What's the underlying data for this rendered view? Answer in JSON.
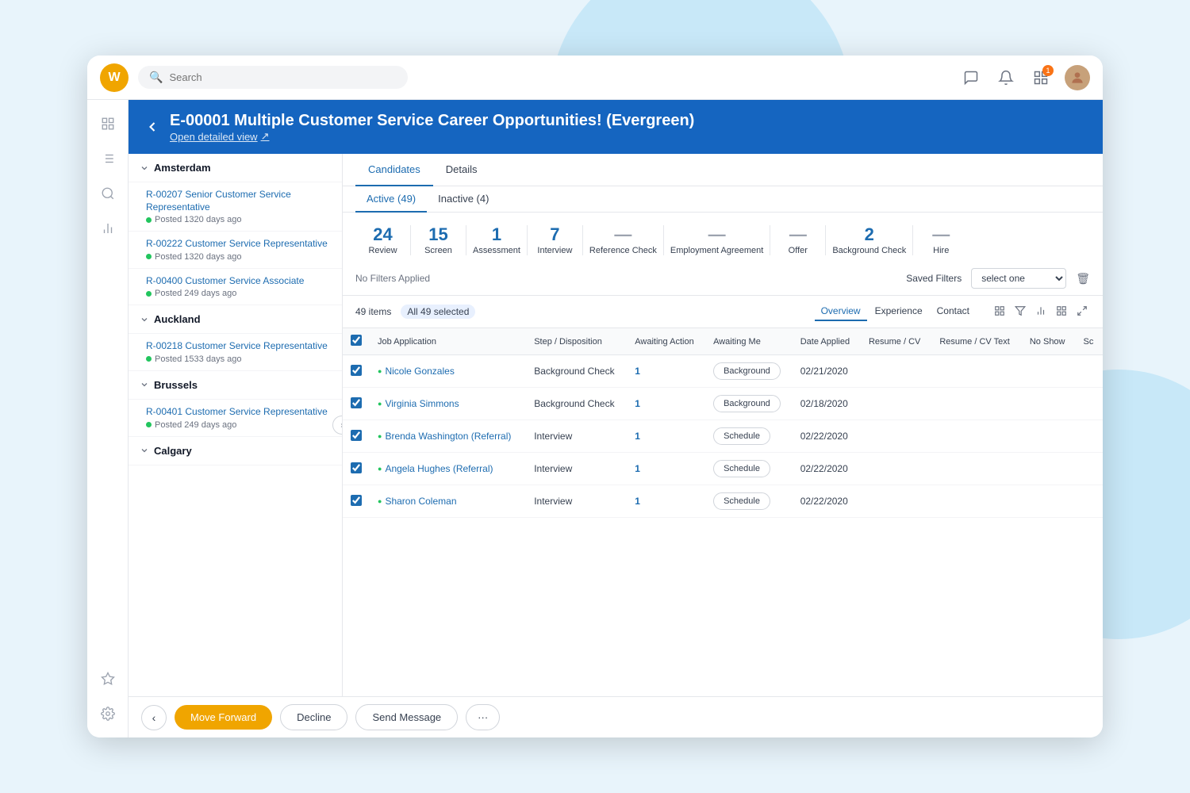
{
  "topbar": {
    "logo_letter": "W",
    "search_placeholder": "Search",
    "notification_badge": "1"
  },
  "header": {
    "back_label": "←",
    "title": "E-00001 Multiple Customer Service Career Opportunities! (Evergreen)",
    "subtitle": "Open detailed view",
    "subtitle_icon": "↗"
  },
  "tabs": {
    "main": [
      {
        "label": "Candidates",
        "active": true
      },
      {
        "label": "Details",
        "active": false
      }
    ],
    "sub": [
      {
        "label": "Active (49)",
        "active": true
      },
      {
        "label": "Inactive (4)",
        "active": false
      }
    ]
  },
  "stages": [
    {
      "count": "24",
      "label": "Review",
      "dim": false
    },
    {
      "count": "15",
      "label": "Screen",
      "dim": false
    },
    {
      "count": "1",
      "label": "Assessment",
      "dim": false
    },
    {
      "count": "7",
      "label": "Interview",
      "dim": false
    },
    {
      "count": "—",
      "label": "Reference Check",
      "dim": true
    },
    {
      "count": "—",
      "label": "Employment Agreement",
      "dim": true
    },
    {
      "count": "—",
      "label": "Offer",
      "dim": true
    },
    {
      "count": "2",
      "label": "Background Check",
      "dim": false
    },
    {
      "count": "—",
      "label": "Hire",
      "dim": true
    }
  ],
  "filters": {
    "no_filters_label": "No Filters Applied",
    "saved_filters_label": "Saved Filters",
    "select_placeholder": "select one"
  },
  "table_toolbar": {
    "items_count": "49 items",
    "all_selected": "All 49 selected",
    "view_tabs": [
      "Overview",
      "Experience",
      "Contact"
    ]
  },
  "table": {
    "headers": [
      "",
      "Job Application",
      "Step / Disposition",
      "Awaiting Action",
      "Awaiting Me",
      "Date Applied",
      "Resume / CV",
      "Resume / CV Text",
      "No Show",
      "Sc"
    ],
    "rows": [
      {
        "checked": true,
        "name": "Nicole Gonzales",
        "step": "Background Check",
        "awaiting": "1",
        "action_label": "Background",
        "date": "02/21/2020"
      },
      {
        "checked": true,
        "name": "Virginia Simmons",
        "step": "Background Check",
        "awaiting": "1",
        "action_label": "Background",
        "date": "02/18/2020"
      },
      {
        "checked": true,
        "name": "Brenda Washington (Referral)",
        "step": "Interview",
        "awaiting": "1",
        "action_label": "Schedule",
        "date": "02/22/2020"
      },
      {
        "checked": true,
        "name": "Angela Hughes (Referral)",
        "step": "Interview",
        "awaiting": "1",
        "action_label": "Schedule",
        "date": "02/22/2020"
      },
      {
        "checked": true,
        "name": "Sharon Coleman",
        "step": "Interview",
        "awaiting": "1",
        "action_label": "Schedule",
        "date": "02/22/2020"
      }
    ]
  },
  "sidebar": {
    "locations": [
      {
        "name": "Amsterdam",
        "jobs": [
          {
            "code": "R-00207",
            "title": "Senior Customer Service Representative",
            "days": "1320"
          },
          {
            "code": "R-00222",
            "title": "Customer Service Representative",
            "days": "1320"
          },
          {
            "code": "R-00400",
            "title": "Customer Service Associate",
            "days": "249"
          }
        ]
      },
      {
        "name": "Auckland",
        "jobs": [
          {
            "code": "R-00218",
            "title": "Customer Service Representative",
            "days": "1533"
          }
        ]
      },
      {
        "name": "Brussels",
        "jobs": [
          {
            "code": "R-00401",
            "title": "Customer Service Representative",
            "days": "249"
          }
        ]
      },
      {
        "name": "Calgary",
        "jobs": []
      }
    ]
  },
  "bottom_bar": {
    "move_forward": "Move Forward",
    "decline": "Decline",
    "send_message": "Send Message",
    "more": "···"
  },
  "nav_icons": [
    "⊞",
    "☰",
    "🔍",
    "📊",
    "☆",
    "⚙"
  ]
}
